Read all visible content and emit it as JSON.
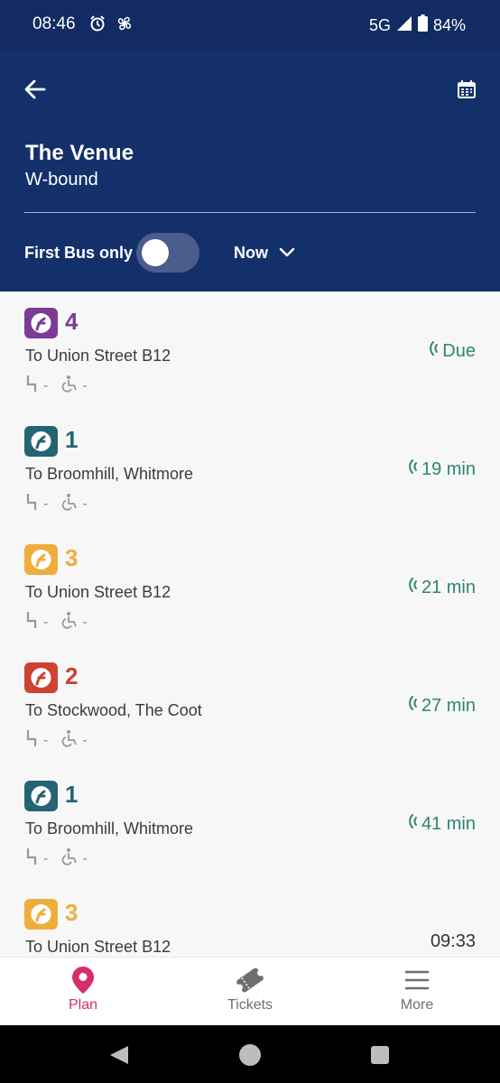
{
  "status_bar": {
    "time": "08:46",
    "network": "5G",
    "battery": "84%"
  },
  "header": {
    "stop_name": "The Venue",
    "direction": "W-bound",
    "filter_label": "First Bus only",
    "filter_on": false,
    "time_select": "Now"
  },
  "departures": [
    {
      "route": "4",
      "color": "#7c3c96",
      "destination": "To Union Street B12",
      "eta": "Due",
      "live": true
    },
    {
      "route": "1",
      "color": "#246473",
      "destination": "To Broomhill, Whitmore",
      "eta": "19 min",
      "live": true
    },
    {
      "route": "3",
      "color": "#eeae3c",
      "destination": "To Union Street B12",
      "eta": "21 min",
      "live": true
    },
    {
      "route": "2",
      "color": "#cd4232",
      "destination": "To Stockwood, The Coot",
      "eta": "27 min",
      "live": true
    },
    {
      "route": "1",
      "color": "#246473",
      "destination": "To Broomhill, Whitmore",
      "eta": "41 min",
      "live": true
    },
    {
      "route": "3",
      "color": "#eeae3c",
      "destination": "To Union Street B12",
      "eta": "09:33",
      "live": false
    }
  ],
  "amenity_placeholder": "-",
  "bottom_nav": {
    "plan": "Plan",
    "tickets": "Tickets",
    "more": "More",
    "active_color": "#d62d6e",
    "inactive_color": "#6f6f6f"
  }
}
